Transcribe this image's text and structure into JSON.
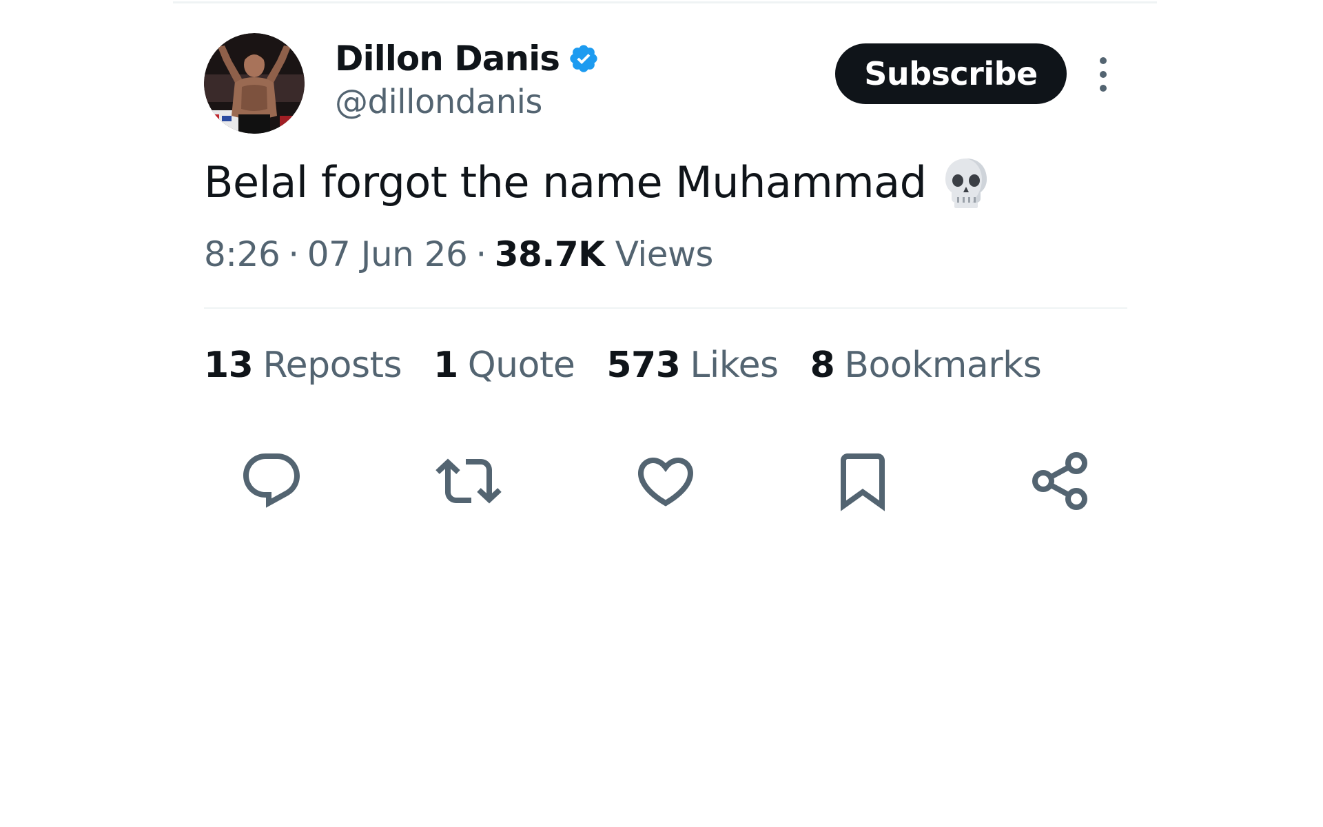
{
  "author": {
    "display_name": "Dillon Danis",
    "handle": "@dillondanis",
    "verified": true
  },
  "header": {
    "subscribe_label": "Subscribe"
  },
  "tweet": {
    "text": "Belal forgot the name Muhammad",
    "emoji": "skull"
  },
  "meta": {
    "time": "8:26",
    "separator": "·",
    "date": "07 Jun 26",
    "views_count": "38.7K",
    "views_label": "Views"
  },
  "stats": [
    {
      "count": "13",
      "label": "Reposts"
    },
    {
      "count": "1",
      "label": "Quote"
    },
    {
      "count": "573",
      "label": "Likes"
    },
    {
      "count": "8",
      "label": "Bookmarks"
    }
  ],
  "actions": [
    "reply-icon",
    "repost-icon",
    "like-icon",
    "bookmark-icon",
    "share-icon"
  ],
  "colors": {
    "text_primary": "#0f1419",
    "text_secondary": "#536471",
    "verified_blue": "#1d9bf0",
    "button_dark": "#0f1419",
    "divider": "#eff3f4"
  }
}
